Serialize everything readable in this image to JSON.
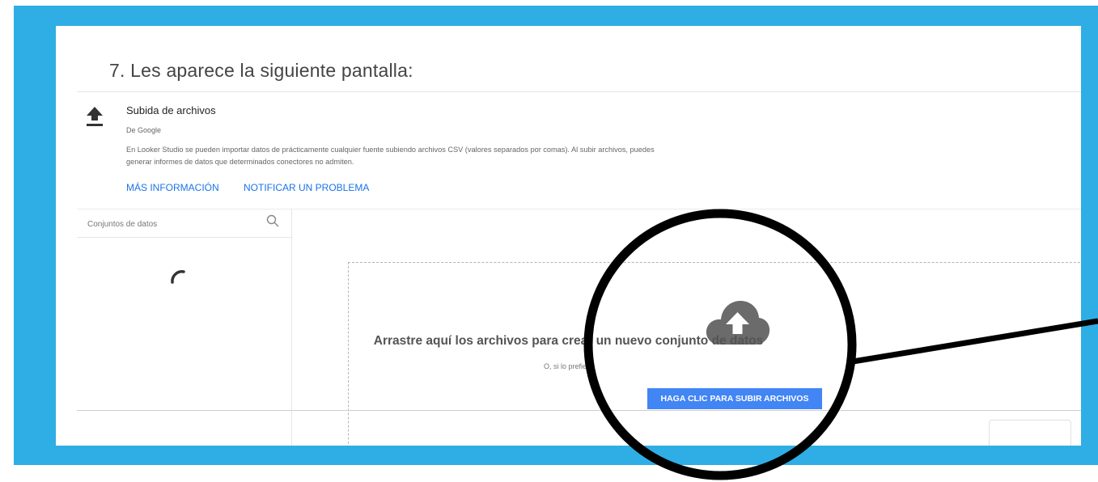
{
  "step_title": "7.  Les aparece la siguiente pantalla:",
  "connector": {
    "name": "Subida de archivos",
    "author": "De Google",
    "description": "En Looker Studio se pueden importar datos de prácticamente cualquier fuente subiendo archivos CSV (valores separados por comas). Al subir archivos, puedes generar informes de datos que determinados conectores no admiten.",
    "links": {
      "more_info": "MÁS INFORMACIÓN",
      "report_problem": "NOTIFICAR UN PROBLEMA"
    },
    "icon": "upload-icon"
  },
  "datasets_panel": {
    "search_placeholder": "Conjuntos de datos",
    "search_icon": "search-icon",
    "loading_indicator": "spinner"
  },
  "dropzone": {
    "icon": "cloud-upload-icon",
    "instruction": "Arrastre aquí los archivos para crear un nuevo conjunto de datos",
    "or_text": "O, si lo prefiere",
    "button_label": "HAGA CLIC PARA SUBIR ARCHIVOS"
  },
  "colors": {
    "frame": "#2eaee4",
    "link": "#1a73e8",
    "button": "#4285f4",
    "annotation": "#000000"
  }
}
